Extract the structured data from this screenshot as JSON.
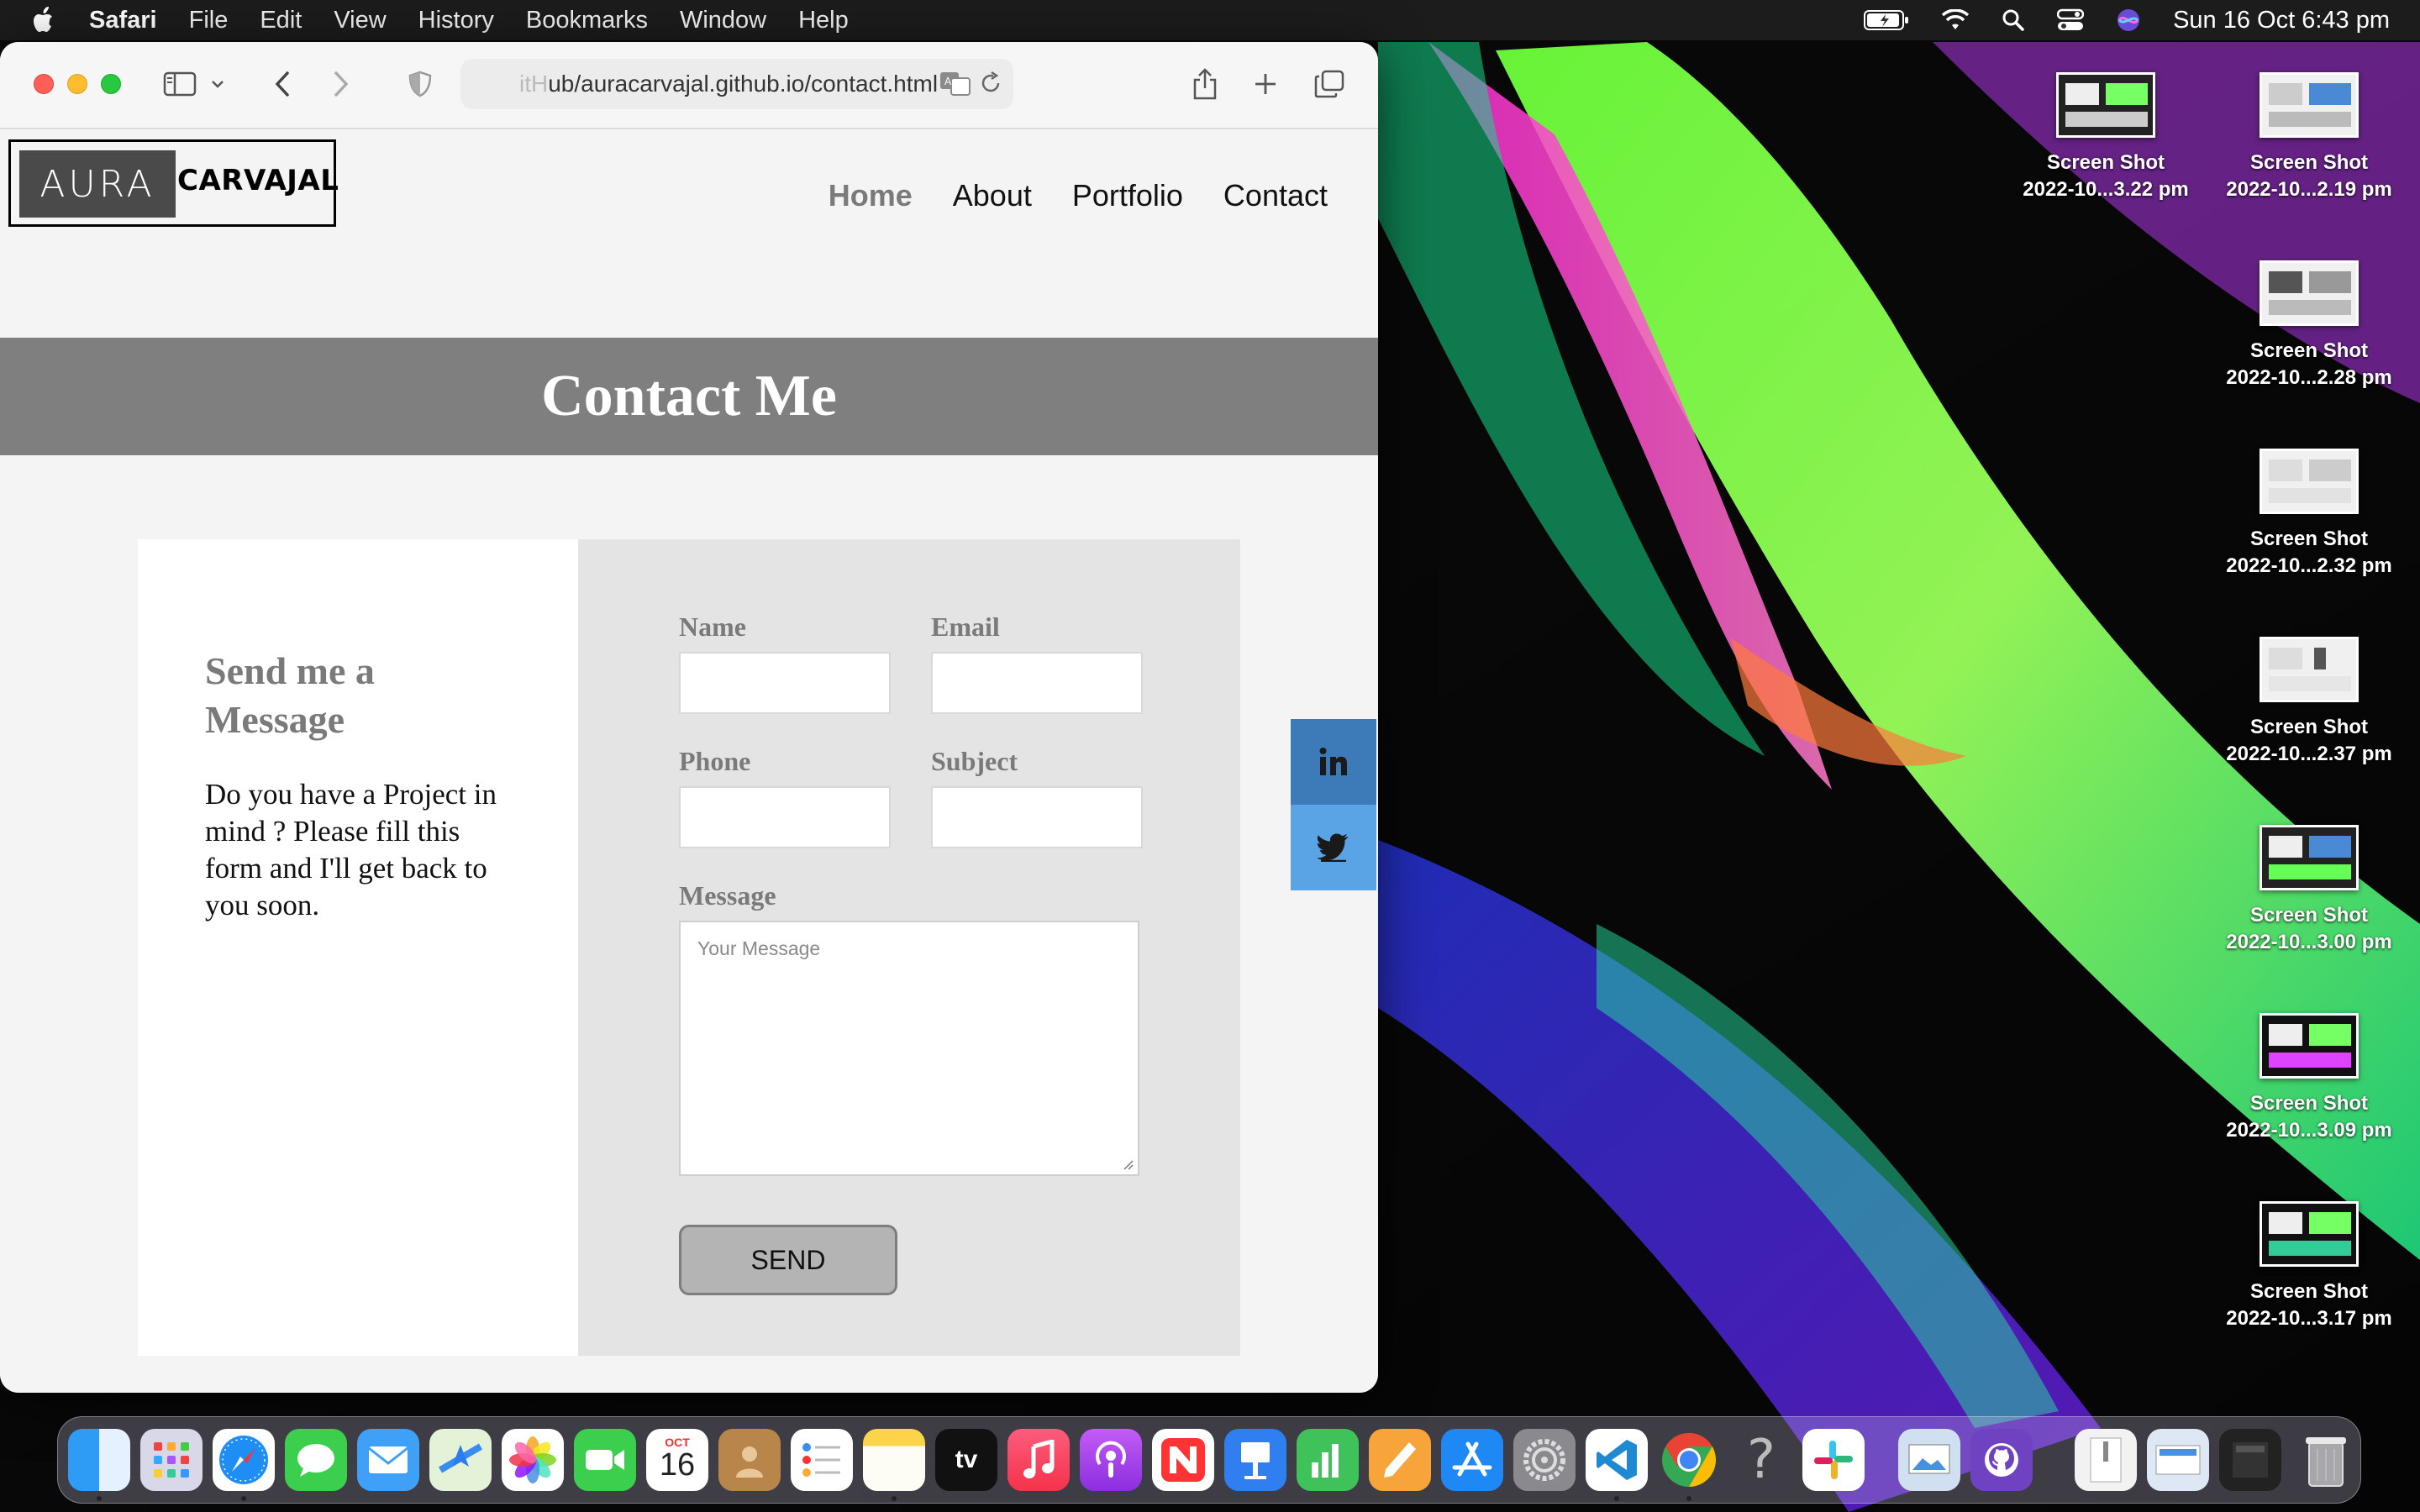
{
  "menubar": {
    "app_name": "Safari",
    "items": [
      "File",
      "Edit",
      "View",
      "History",
      "Bookmarks",
      "Window",
      "Help"
    ],
    "clock": "Sun 16 Oct  6:43 pm"
  },
  "browser": {
    "url_faded": "itH",
    "url": "ub/auracarvajal.github.io/contact.html"
  },
  "site": {
    "logo_left": "AURA",
    "logo_right": "CARVAJAL",
    "nav": [
      {
        "label": "Home",
        "active": true
      },
      {
        "label": "About",
        "active": false
      },
      {
        "label": "Portfolio",
        "active": false
      },
      {
        "label": "Contact",
        "active": false
      }
    ],
    "banner_title": "Contact Me",
    "intro_heading": "Send me a Message",
    "intro_text": "Do you have a Project in mind ? Please fill this form and I'll get back to you soon.",
    "form": {
      "name_label": "Name",
      "email_label": "Email",
      "phone_label": "Phone",
      "subject_label": "Subject",
      "message_label": "Message",
      "message_placeholder": "Your Message",
      "send_label": "SEND"
    },
    "social": [
      "linkedin",
      "twitter"
    ]
  },
  "desktop_icons": [
    {
      "line1": "Screen Shot",
      "line2": "2022-10...3.22 pm"
    },
    {
      "line1": "Screen Shot",
      "line2": "2022-10...2.19 pm"
    },
    {
      "line1": "Screen Shot",
      "line2": "2022-10...2.28 pm"
    },
    {
      "line1": "Screen Shot",
      "line2": "2022-10...2.32 pm"
    },
    {
      "line1": "Screen Shot",
      "line2": "2022-10...2.37 pm"
    },
    {
      "line1": "Screen Shot",
      "line2": "2022-10...3.00 pm"
    },
    {
      "line1": "Screen Shot",
      "line2": "2022-10...3.09 pm"
    },
    {
      "line1": "Screen Shot",
      "line2": "2022-10...3.17 pm"
    }
  ],
  "dock": {
    "calendar_month": "OCT",
    "calendar_day": "16",
    "tv_label": "tv",
    "apps": [
      "finder",
      "launchpad",
      "safari",
      "messages",
      "mail",
      "maps",
      "photos",
      "facetime",
      "calendar",
      "contacts",
      "reminders",
      "notes",
      "tv",
      "music",
      "podcasts",
      "news",
      "keynote",
      "numbers",
      "pages",
      "app-store",
      "system-preferences",
      "vscode",
      "chrome",
      "help",
      "slack",
      "preview",
      "github-desktop",
      "archive",
      "screenshot",
      "terminal",
      "trash"
    ]
  }
}
